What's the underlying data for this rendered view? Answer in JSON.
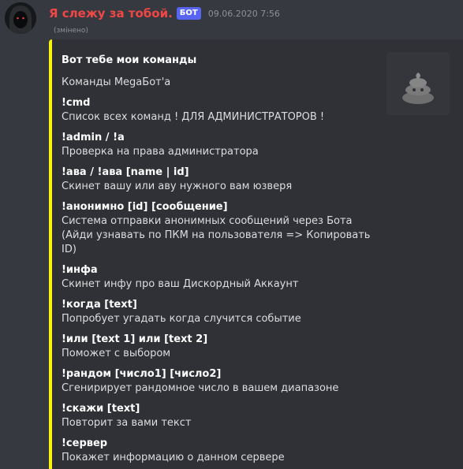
{
  "message": {
    "author": "Я слежу за тобой.",
    "bot_tag": "БОТ",
    "timestamp": "09.06.2020 7:56",
    "edited": "(змінено)"
  },
  "embed": {
    "accent_color": "#f7f40d",
    "title": "Вот тебе мои команды",
    "description": "Команды MegaБот'а",
    "thumbnail_icon": "poop-icon",
    "fields": [
      {
        "name": "!cmd",
        "value": "Список всех команд ! ДЛЯ АДМИНИСТРАТОРОВ !"
      },
      {
        "name": "!admin / !a",
        "value": "Проверка на права администратора"
      },
      {
        "name": "!ава / !ава [name | id]",
        "value": "Скинет вашу или аву нужного вам юзверя"
      },
      {
        "name": "!анонимно [id] [сообщение]",
        "value": "Система отправки анонимных сообщений через Бота (Айди узнавать по ПКМ на пользователя => Копировать ID)"
      },
      {
        "name": "!инфа",
        "value": "Скинет инфу про ваш Дискордный Аккаунт"
      },
      {
        "name": "!когда [text]",
        "value": "Попробует угадать когда случится событие"
      },
      {
        "name": "!или [text 1] или [text 2]",
        "value": "Поможет с выбором"
      },
      {
        "name": "!рандом [число1] [число2]",
        "value": "Сгенирирует рандомное число в вашем диапазоне"
      },
      {
        "name": "!скажи [text]",
        "value": "Повторит за вами текст"
      },
      {
        "name": "!сервер",
        "value": "Покажет информацию о данном сервере"
      }
    ]
  },
  "colors": {
    "background": "#36393f",
    "embed_background": "#2f3136",
    "username": "#f04747",
    "bot_tag": "#5865f2"
  }
}
